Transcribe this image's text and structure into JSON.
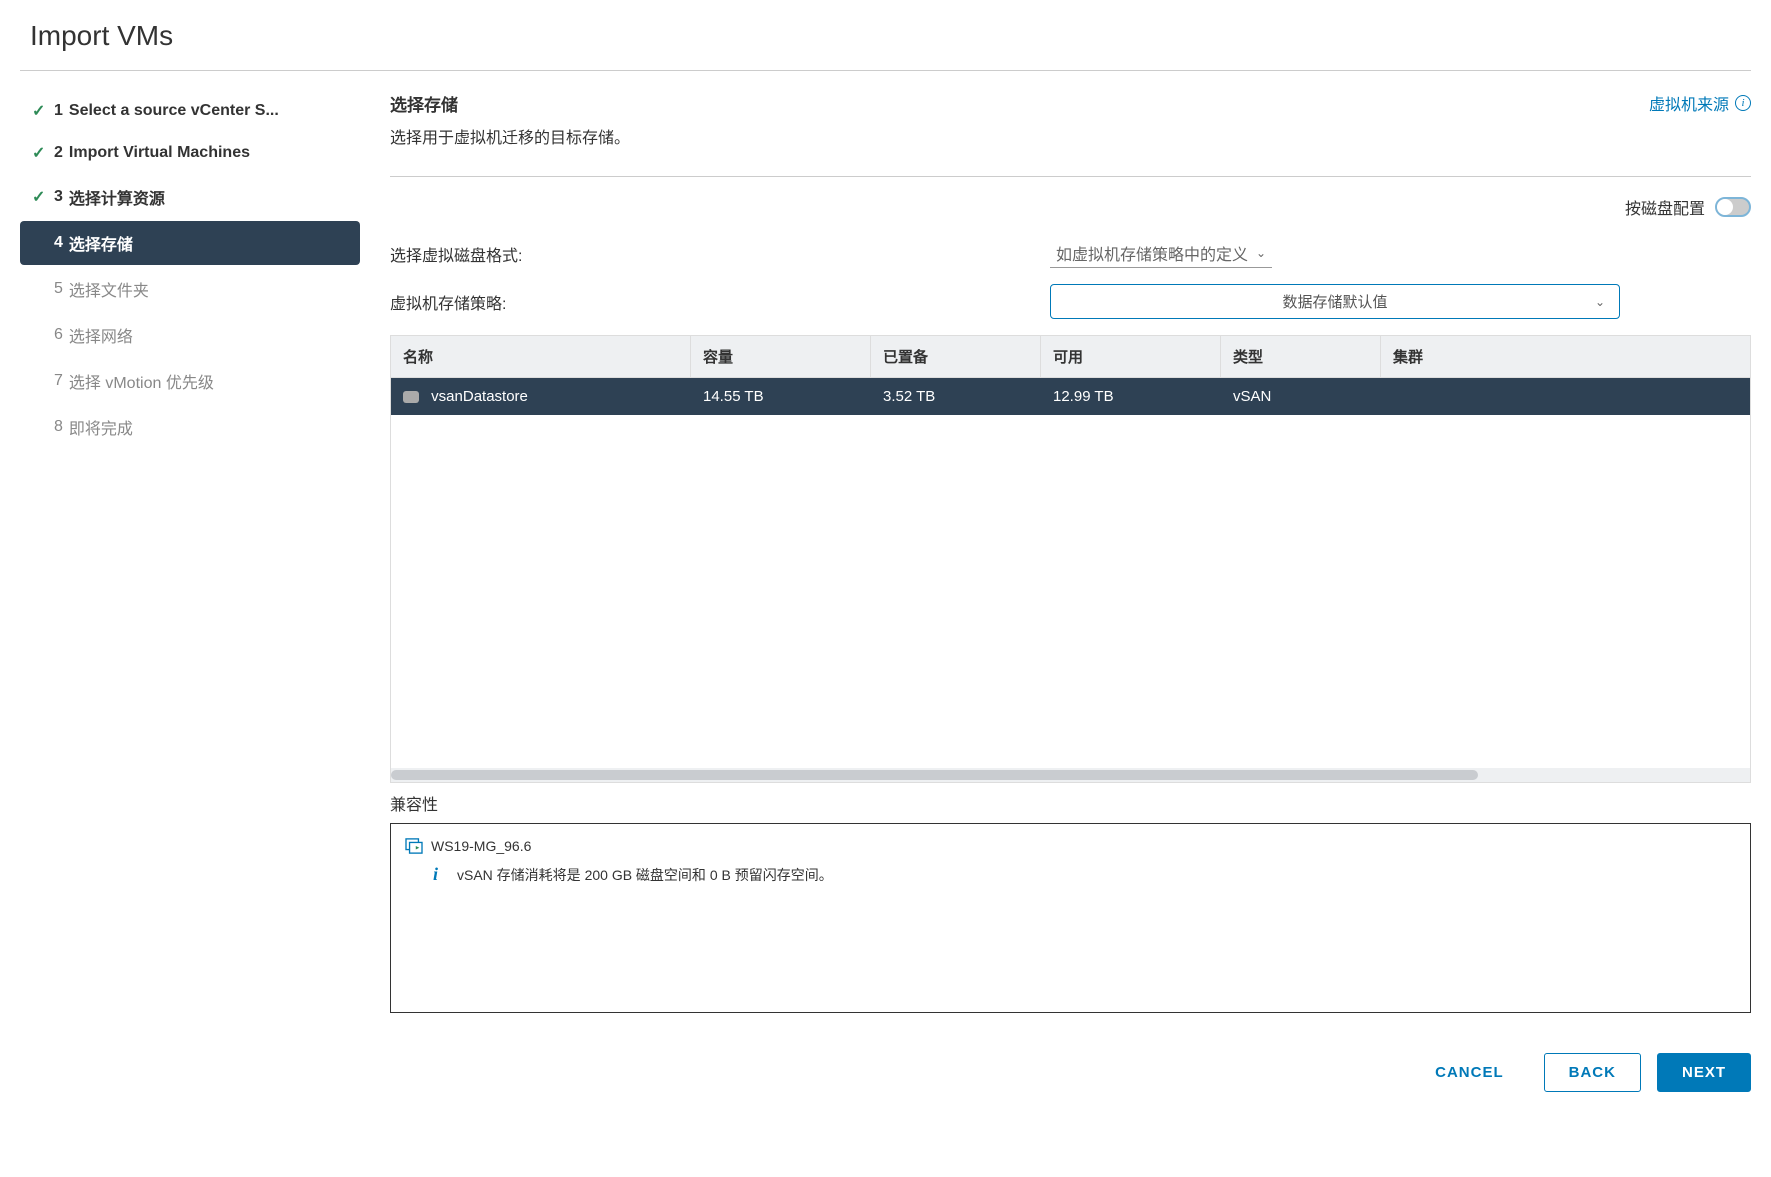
{
  "page_title": "Import VMs",
  "steps": [
    {
      "num": "1",
      "label": "Select a source vCenter S...",
      "status": "complete"
    },
    {
      "num": "2",
      "label": "Import Virtual Machines",
      "status": "complete"
    },
    {
      "num": "3",
      "label": "选择计算资源",
      "status": "complete"
    },
    {
      "num": "4",
      "label": "选择存储",
      "status": "active"
    },
    {
      "num": "5",
      "label": "选择文件夹",
      "status": "pending"
    },
    {
      "num": "6",
      "label": "选择网络",
      "status": "pending"
    },
    {
      "num": "7",
      "label": "选择 vMotion 优先级",
      "status": "pending"
    },
    {
      "num": "8",
      "label": "即将完成",
      "status": "pending"
    }
  ],
  "main": {
    "title": "选择存储",
    "subtitle": "选择用于虚拟机迁移的目标存储。",
    "source_link": "虚拟机来源",
    "toggle_label": "按磁盘配置",
    "toggle_on": false,
    "disk_format_label": "选择虚拟磁盘格式:",
    "disk_format_value": "如虚拟机存储策略中的定义",
    "policy_label": "虚拟机存储策略:",
    "policy_value": "数据存储默认值"
  },
  "table": {
    "headers": {
      "name": "名称",
      "capacity": "容量",
      "provisioned": "已置备",
      "free": "可用",
      "type": "类型",
      "cluster": "集群"
    },
    "rows": [
      {
        "name": "vsanDatastore",
        "capacity": "14.55 TB",
        "provisioned": "3.52 TB",
        "free": "12.99 TB",
        "type": "vSAN",
        "cluster": ""
      }
    ]
  },
  "compatibility": {
    "title": "兼容性",
    "vm_name": "WS19-MG_96.6",
    "message": "vSAN 存储消耗将是 200 GB 磁盘空间和 0 B 预留闪存空间。"
  },
  "footer": {
    "cancel": "CANCEL",
    "back": "BACK",
    "next": "NEXT"
  }
}
